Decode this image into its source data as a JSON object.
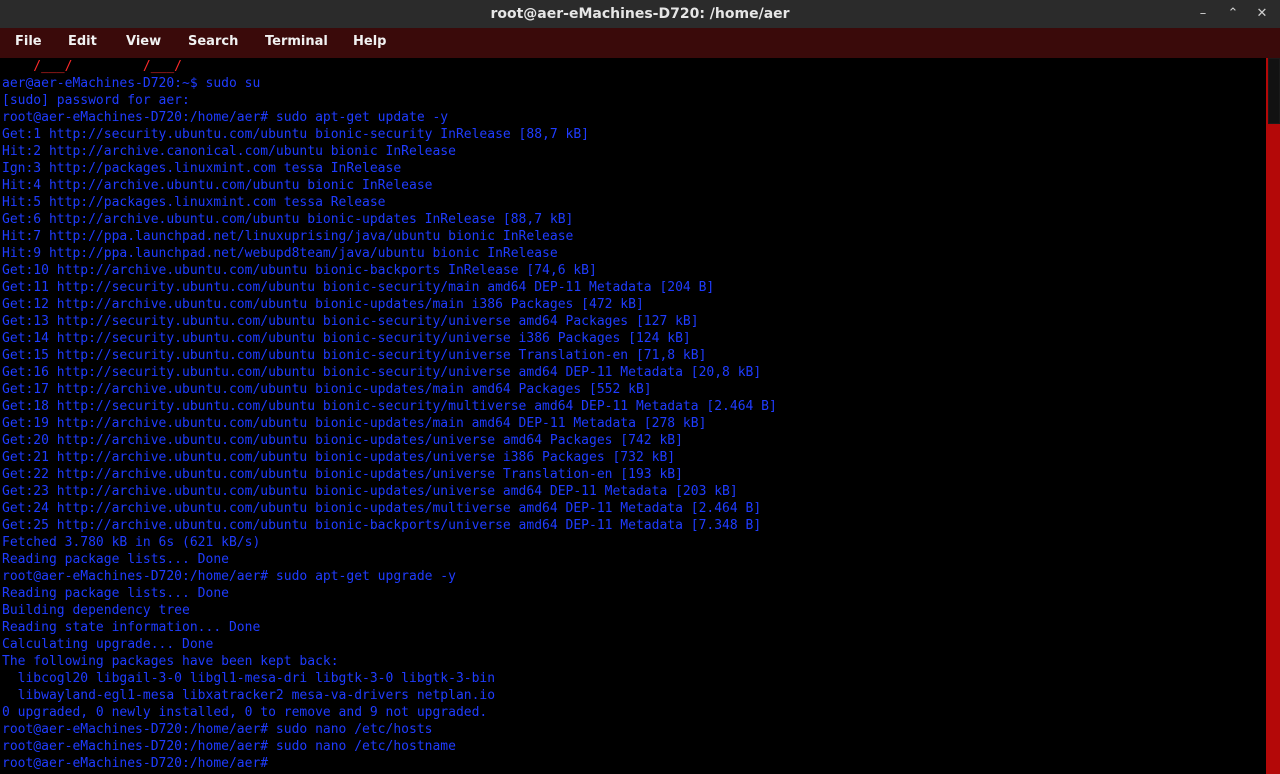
{
  "window": {
    "title": "root@aer-eMachines-D720: /home/aer",
    "controls": {
      "minimize_icon": "minimize-icon",
      "maximize_icon": "maximize-icon",
      "close_icon": "close-icon",
      "minimize_glyph": "–",
      "maximize_glyph": "⌃",
      "close_glyph": "✕"
    }
  },
  "menu": {
    "items": [
      "File",
      "Edit",
      "View",
      "Search",
      "Terminal",
      "Help"
    ]
  },
  "terminal": {
    "colors": {
      "text": "#1f3cff",
      "ascii_art": "#ff2a2a",
      "background": "#000000",
      "scrollbar": "#b40808"
    },
    "lines": [
      "    /___/         /___/",
      "aer@aer-eMachines-D720:~$ sudo su",
      "[sudo] password for aer:",
      "root@aer-eMachines-D720:/home/aer# sudo apt-get update -y",
      "Get:1 http://security.ubuntu.com/ubuntu bionic-security InRelease [88,7 kB]",
      "Hit:2 http://archive.canonical.com/ubuntu bionic InRelease",
      "Ign:3 http://packages.linuxmint.com tessa InRelease",
      "Hit:4 http://archive.ubuntu.com/ubuntu bionic InRelease",
      "Hit:5 http://packages.linuxmint.com tessa Release",
      "Get:6 http://archive.ubuntu.com/ubuntu bionic-updates InRelease [88,7 kB]",
      "Hit:7 http://ppa.launchpad.net/linuxuprising/java/ubuntu bionic InRelease",
      "Hit:9 http://ppa.launchpad.net/webupd8team/java/ubuntu bionic InRelease",
      "Get:10 http://archive.ubuntu.com/ubuntu bionic-backports InRelease [74,6 kB]",
      "Get:11 http://security.ubuntu.com/ubuntu bionic-security/main amd64 DEP-11 Metadata [204 B]",
      "Get:12 http://archive.ubuntu.com/ubuntu bionic-updates/main i386 Packages [472 kB]",
      "Get:13 http://security.ubuntu.com/ubuntu bionic-security/universe amd64 Packages [127 kB]",
      "Get:14 http://security.ubuntu.com/ubuntu bionic-security/universe i386 Packages [124 kB]",
      "Get:15 http://security.ubuntu.com/ubuntu bionic-security/universe Translation-en [71,8 kB]",
      "Get:16 http://security.ubuntu.com/ubuntu bionic-security/universe amd64 DEP-11 Metadata [20,8 kB]",
      "Get:17 http://archive.ubuntu.com/ubuntu bionic-updates/main amd64 Packages [552 kB]",
      "Get:18 http://security.ubuntu.com/ubuntu bionic-security/multiverse amd64 DEP-11 Metadata [2.464 B]",
      "Get:19 http://archive.ubuntu.com/ubuntu bionic-updates/main amd64 DEP-11 Metadata [278 kB]",
      "Get:20 http://archive.ubuntu.com/ubuntu bionic-updates/universe amd64 Packages [742 kB]",
      "Get:21 http://archive.ubuntu.com/ubuntu bionic-updates/universe i386 Packages [732 kB]",
      "Get:22 http://archive.ubuntu.com/ubuntu bionic-updates/universe Translation-en [193 kB]",
      "Get:23 http://archive.ubuntu.com/ubuntu bionic-updates/universe amd64 DEP-11 Metadata [203 kB]",
      "Get:24 http://archive.ubuntu.com/ubuntu bionic-updates/multiverse amd64 DEP-11 Metadata [2.464 B]",
      "Get:25 http://archive.ubuntu.com/ubuntu bionic-backports/universe amd64 DEP-11 Metadata [7.348 B]",
      "Fetched 3.780 kB in 6s (621 kB/s)",
      "Reading package lists... Done",
      "root@aer-eMachines-D720:/home/aer# sudo apt-get upgrade -y",
      "Reading package lists... Done",
      "Building dependency tree",
      "Reading state information... Done",
      "Calculating upgrade... Done",
      "The following packages have been kept back:",
      "  libcogl20 libgail-3-0 libgl1-mesa-dri libgtk-3-0 libgtk-3-bin",
      "  libwayland-egl1-mesa libxatracker2 mesa-va-drivers netplan.io",
      "0 upgraded, 0 newly installed, 0 to remove and 9 not upgraded.",
      "root@aer-eMachines-D720:/home/aer# sudo nano /etc/hosts",
      "root@aer-eMachines-D720:/home/aer# sudo nano /etc/hostname",
      "root@aer-eMachines-D720:/home/aer# "
    ]
  }
}
